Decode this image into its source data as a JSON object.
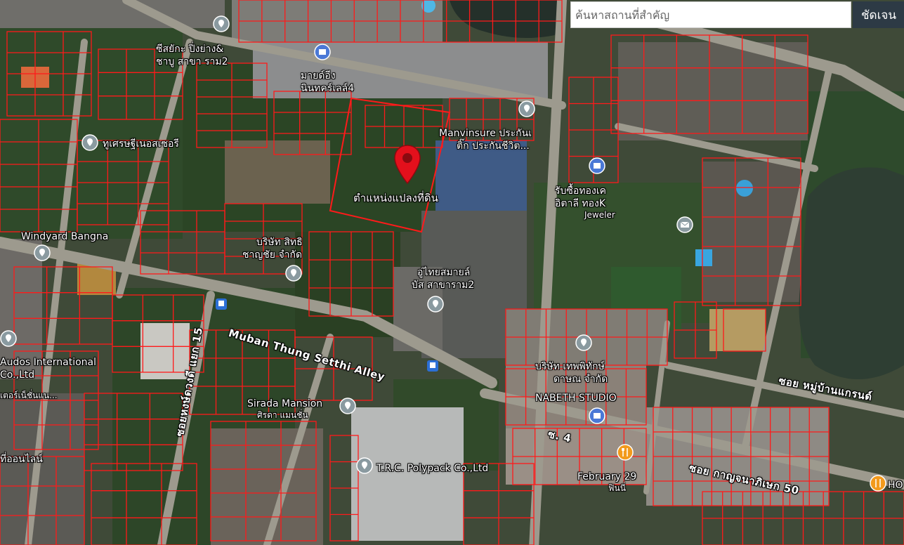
{
  "search": {
    "placeholder": "ค้นหาสถานที่สำคัญ",
    "button_label": "ชัดเจน"
  },
  "parcel": {
    "label": "ตำแหน่งแปลงที่ดิน",
    "pin_color": "#e3101c"
  },
  "colors": {
    "parcel_line": "#ff1a1a",
    "road": "#9b9a8e",
    "poi_pin": "#8a9aa0",
    "shop_pin": "#4a78d6",
    "food_pin": "#f29a1c"
  },
  "places": [
    {
      "name": "ซีสยักะ ปิ่งย่าง&",
      "line2": "ชาบู สาขา ราม2",
      "icon": "poi-pin-icon"
    },
    {
      "name": "มายด์อีง",
      "line2": "นินทคร์เลล์4",
      "icon": "shop-pin-icon"
    },
    {
      "name": "ทูเศรษฐีเนอสเซอรี",
      "icon": "poi-pin-icon"
    },
    {
      "name": "Manvinsure ประกันเ",
      "line2": "ติ๊ก ประกันชีวิต...",
      "icon": "poi-pin-icon"
    },
    {
      "name": "รับซื้อทองเค",
      "line2": "อิตาลี ทองK",
      "line3": "Jeweler",
      "icon": "shop-pin-icon"
    },
    {
      "name": "Windyard Bangna",
      "icon": "poi-pin-icon"
    },
    {
      "name": "บริษัท สิทธิ",
      "line2": "ชาญชัย จำกัด",
      "icon": "poi-pin-icon"
    },
    {
      "name": "อู่ไทยสมายล์",
      "line2": "บัส สาขาราม2",
      "icon": "poi-pin-icon"
    },
    {
      "name": "Audos International",
      "line2": "Co.,Ltd",
      "line3": "เตอร์เน็ชั่นแน...",
      "icon": "poi-pin-icon"
    },
    {
      "name": "บริษัท เทพพิทักษ์",
      "line2": "ดาษณ จำกัด",
      "icon": "poi-pin-icon"
    },
    {
      "name": "NABETH STUDIO",
      "icon": "shop-pin-icon"
    },
    {
      "name": "Sirada Mansion",
      "line2": "ศิรดา แมนชั่น",
      "icon": "poi-pin-icon"
    },
    {
      "name": "T.R.C. Polypack Co.,Ltd",
      "icon": "poi-pin-icon"
    },
    {
      "name": "February 29",
      "line2": "ฟินนี่",
      "icon": "food-pin-icon"
    },
    {
      "name": "HO",
      "icon": "food-pin-icon"
    },
    {
      "name": "ที่ออนไลน์",
      "icon": "none"
    }
  ],
  "roads": [
    {
      "name": "Muban Thung Setthi Alley"
    },
    {
      "name": "ซอยหงษ์ดวงดี แยก 15"
    },
    {
      "name": "ซอย หมู่บ้านแกรนด์"
    },
    {
      "name": "ซอย กาญจนาภิเษก 50"
    },
    {
      "name": "ซ. 4"
    }
  ]
}
